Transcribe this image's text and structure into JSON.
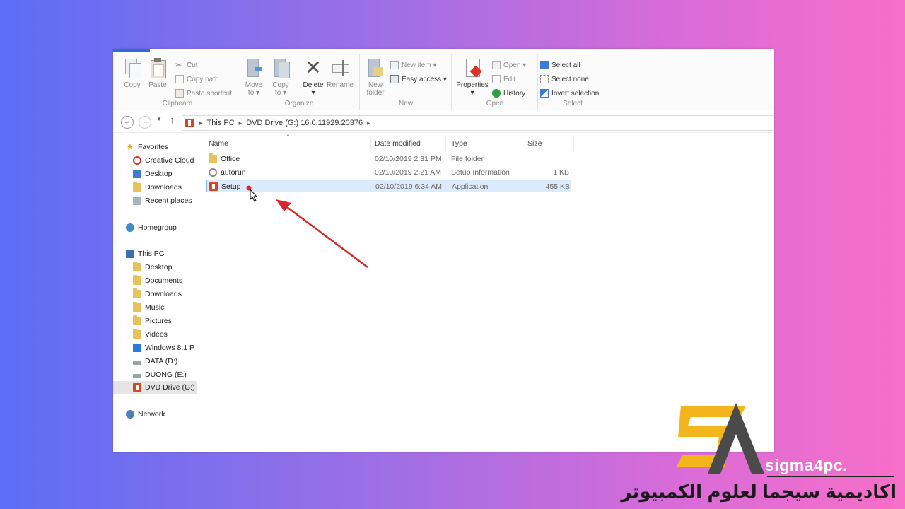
{
  "ribbon": {
    "clipboard": {
      "label": "Clipboard",
      "copy": "Copy",
      "paste": "Paste",
      "cut": "Cut",
      "copy_path": "Copy path",
      "paste_shortcut": "Paste shortcut"
    },
    "organize": {
      "label": "Organize",
      "move_to_1": "Move",
      "move_to_2": "to ▾",
      "copy_to_1": "Copy",
      "copy_to_2": "to ▾",
      "delete": "Delete",
      "delete_arrow": "▾",
      "rename": "Rename"
    },
    "new": {
      "label": "New",
      "new_folder_1": "New",
      "new_folder_2": "folder",
      "new_item": "New item ▾",
      "easy_access": "Easy access ▾"
    },
    "open": {
      "label": "Open",
      "properties": "Properties",
      "properties_arrow": "▾",
      "open": "Open ▾",
      "edit": "Edit",
      "history": "History"
    },
    "select": {
      "label": "Select",
      "select_all": "Select all",
      "select_none": "Select none",
      "invert_selection": "Invert selection"
    }
  },
  "address": {
    "crumbs": [
      "This PC",
      "DVD Drive (G:) 16.0.11929.20376"
    ]
  },
  "nav": {
    "favorites": "Favorites",
    "creative_cloud": "Creative Cloud",
    "desktop": "Desktop",
    "downloads": "Downloads",
    "recent_places": "Recent places",
    "homegroup": "Homegroup",
    "this_pc": "This PC",
    "pc_desktop": "Desktop",
    "documents": "Documents",
    "pc_downloads": "Downloads",
    "music": "Music",
    "pictures": "Pictures",
    "videos": "Videos",
    "windows": "Windows 8.1 P",
    "data_drive": "DATA (D:)",
    "duong_drive": "DUONG (E:)",
    "dvd_drive": "DVD Drive (G:)",
    "network": "Network"
  },
  "columns": {
    "name": "Name",
    "date_modified": "Date modified",
    "type": "Type",
    "size": "Size"
  },
  "files": [
    {
      "name": "Office",
      "date": "02/10/2019 2:31 PM",
      "type": "File folder",
      "size": ""
    },
    {
      "name": "autorun",
      "date": "02/10/2019 2:21 AM",
      "type": "Setup Information",
      "size": "1 KB"
    },
    {
      "name": "Setup",
      "date": "02/10/2019 6:34 AM",
      "type": "Application",
      "size": "455 KB"
    }
  ],
  "watermark": {
    "brand": "sigma4pc.",
    "arabic": "اكاديمية سيجما لعلوم الكمبيوتر"
  },
  "colors": {
    "annotation_arrow": "#d9262b",
    "logo_gold": "#f2b51c",
    "logo_gray": "#4a4a4a"
  }
}
